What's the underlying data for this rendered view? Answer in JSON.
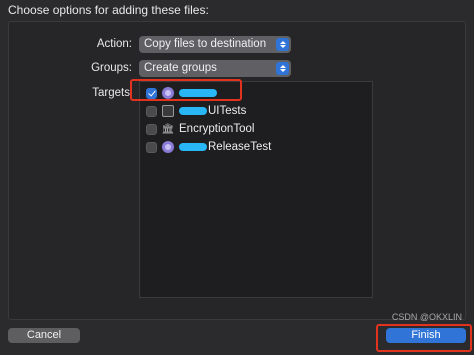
{
  "dialog": {
    "title": "Choose options for adding these files:"
  },
  "action": {
    "label": "Action:",
    "value": "Copy files to destination"
  },
  "groups": {
    "label": "Groups:",
    "value": "Create groups"
  },
  "targets": {
    "label": "Targets",
    "items": [
      {
        "name": "",
        "checked": true,
        "icon": "app-target-icon"
      },
      {
        "name": "UITests",
        "checked": false,
        "icon": "ui-test-target-icon"
      },
      {
        "name": "EncryptionTool",
        "checked": false,
        "icon": "framework-target-icon"
      },
      {
        "name": "ReleaseTest",
        "checked": false,
        "icon": "app-target-icon"
      }
    ]
  },
  "buttons": {
    "cancel": "Cancel",
    "finish": "Finish"
  },
  "watermark": "CSDN @OKXLIN",
  "colors": {
    "accent": "#2f74d6",
    "highlight": "#e2331f",
    "redaction": "#29b6f6"
  }
}
